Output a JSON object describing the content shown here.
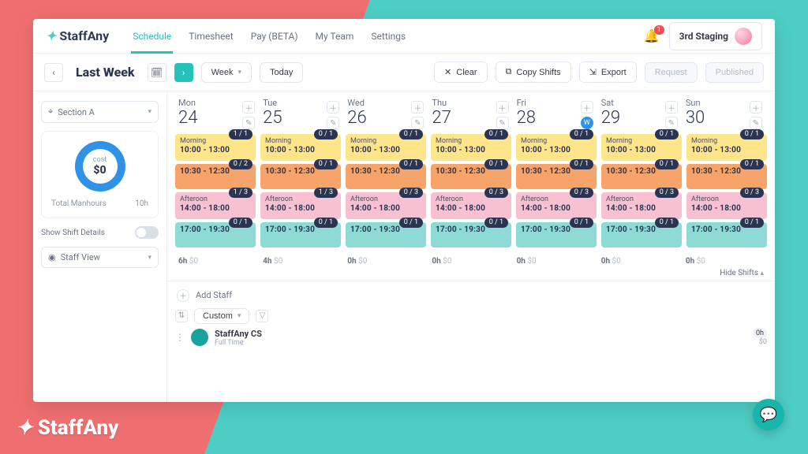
{
  "header": {
    "brand": "StaffAny",
    "nav": [
      "Schedule",
      "Timesheet",
      "Pay (BETA)",
      "My Team",
      "Settings"
    ],
    "active_nav": "Schedule",
    "notification_count": "1",
    "workspace_label": "3rd Staging"
  },
  "toolbar": {
    "title": "Last Week",
    "period_label": "Week",
    "today_label": "Today",
    "clear_label": "Clear",
    "copy_label": "Copy Shifts",
    "export_label": "Export",
    "request_label": "Request",
    "published_label": "Published"
  },
  "sidebar": {
    "section_label": "Section A",
    "cost_label": "cost",
    "cost_amount": "$0",
    "manhours_label": "Total Manhours",
    "manhours_value": "10h",
    "details_label": "Show Shift Details",
    "view_label": "Staff View"
  },
  "days": [
    {
      "dow": "Mon",
      "num": "24",
      "weather": false
    },
    {
      "dow": "Tue",
      "num": "25",
      "weather": false
    },
    {
      "dow": "Wed",
      "num": "26",
      "weather": false
    },
    {
      "dow": "Thu",
      "num": "27",
      "weather": false
    },
    {
      "dow": "Fri",
      "num": "28",
      "weather": true
    },
    {
      "dow": "Sat",
      "num": "29",
      "weather": false
    },
    {
      "dow": "Sun",
      "num": "30",
      "weather": false
    }
  ],
  "shift_rows": [
    {
      "color": "c-yellow",
      "cells": [
        {
          "label": "Morning",
          "time": "10:00 - 13:00",
          "badge": "1 / 1"
        },
        {
          "label": "Morning",
          "time": "10:00 - 13:00",
          "badge": "0 / 1"
        },
        {
          "label": "Morning",
          "time": "10:00 - 13:00",
          "badge": "0 / 1"
        },
        {
          "label": "Morning",
          "time": "10:00 - 13:00",
          "badge": "0 / 1"
        },
        {
          "label": "Morning",
          "time": "10:00 - 13:00",
          "badge": "0 / 1"
        },
        {
          "label": "Morning",
          "time": "10:00 - 13:00",
          "badge": "0 / 1"
        },
        {
          "label": "Morning",
          "time": "10:00 - 13:00",
          "badge": "0 / 1"
        }
      ]
    },
    {
      "color": "c-orange",
      "cells": [
        {
          "label": "",
          "time": "10:30 - 12:30",
          "badge": "0 / 2"
        },
        {
          "label": "",
          "time": "10:30 - 12:30",
          "badge": "0 / 1"
        },
        {
          "label": "",
          "time": "10:30 - 12:30",
          "badge": "0 / 1"
        },
        {
          "label": "",
          "time": "10:30 - 12:30",
          "badge": "0 / 1"
        },
        {
          "label": "",
          "time": "10:30 - 12:30",
          "badge": "0 / 1"
        },
        {
          "label": "",
          "time": "10:30 - 12:30",
          "badge": "0 / 1"
        },
        {
          "label": "",
          "time": "10:30 - 12:30",
          "badge": "0 / 1"
        }
      ]
    },
    {
      "color": "c-pink",
      "cells": [
        {
          "label": "Afteroon",
          "time": "14:00 - 18:00",
          "badge": "1 / 3"
        },
        {
          "label": "Afteroon",
          "time": "14:00 - 18:00",
          "badge": "1 / 3"
        },
        {
          "label": "Afteroon",
          "time": "14:00 - 18:00",
          "badge": "0 / 3"
        },
        {
          "label": "Afteroon",
          "time": "14:00 - 18:00",
          "badge": "0 / 3"
        },
        {
          "label": "Afteroon",
          "time": "14:00 - 18:00",
          "badge": "0 / 3"
        },
        {
          "label": "Afteroon",
          "time": "14:00 - 18:00",
          "badge": "0 / 3"
        },
        {
          "label": "Afteroon",
          "time": "14:00 - 18:00",
          "badge": "0 / 3"
        }
      ]
    },
    {
      "color": "c-teal",
      "cells": [
        {
          "label": "",
          "time": "17:00 - 19:30",
          "badge": "0 / 1"
        },
        {
          "label": "",
          "time": "17:00 - 19:30",
          "badge": "0 / 1"
        },
        {
          "label": "",
          "time": "17:00 - 19:30",
          "badge": "0 / 1"
        },
        {
          "label": "",
          "time": "17:00 - 19:30",
          "badge": "0 / 1"
        },
        {
          "label": "",
          "time": "17:00 - 19:30",
          "badge": "0 / 1"
        },
        {
          "label": "",
          "time": "17:00 - 19:30",
          "badge": "0 / 1"
        },
        {
          "label": "",
          "time": "17:00 - 19:30",
          "badge": "0 / 1"
        }
      ]
    }
  ],
  "summary": [
    {
      "hours": "6h",
      "cost": "$0"
    },
    {
      "hours": "4h",
      "cost": "$0"
    },
    {
      "hours": "0h",
      "cost": "$0"
    },
    {
      "hours": "0h",
      "cost": "$0"
    },
    {
      "hours": "0h",
      "cost": "$0"
    },
    {
      "hours": "0h",
      "cost": "$0"
    },
    {
      "hours": "0h",
      "cost": "$0"
    }
  ],
  "hide_shifts_label": "Hide Shifts",
  "staff": {
    "add_label": "Add Staff",
    "sort_label": "Custom",
    "row_name": "StaffAny CS",
    "row_sub": "Full Time",
    "row_hours": "0h",
    "row_cost": "$0"
  },
  "overlay_brand": "StaffAny"
}
